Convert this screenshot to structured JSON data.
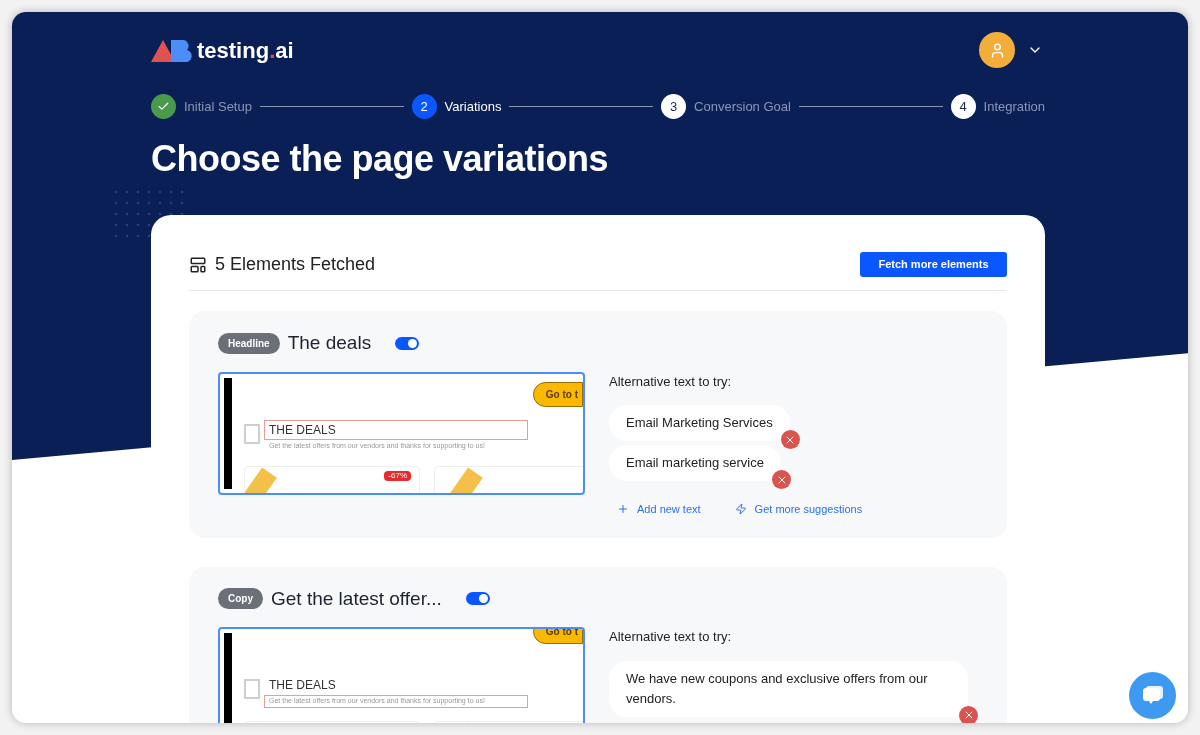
{
  "logo": {
    "name": "testing",
    "dot": ".",
    "suffix": "ai"
  },
  "steps": [
    {
      "label": "Initial Setup",
      "done": true,
      "selected": false
    },
    {
      "number": "2",
      "label": "Variations",
      "done": false,
      "selected": true
    },
    {
      "number": "3",
      "label": "Conversion Goal",
      "done": false,
      "selected": false
    },
    {
      "number": "4",
      "label": "Integration",
      "done": false,
      "selected": false
    }
  ],
  "title": "Choose the page variations",
  "panel": {
    "title": "5 Elements Fetched",
    "fetch_button": "Fetch more elements"
  },
  "elements": [
    {
      "badge": "Headline",
      "name": "The deals",
      "enabled": true,
      "preview": {
        "cta": "Go to t",
        "heading": "THE DEALS",
        "subtext": "Get the latest offers from our vendors and thanks for supporting to us!",
        "discount": "-67%",
        "heading_highlighted": true,
        "subtext_highlighted": false,
        "cta_cut": false
      },
      "alternatives_label": "Alternative text to try:",
      "alternatives": [
        "Email Marketing Services",
        "Email marketing service"
      ],
      "actions": [
        {
          "kind": "add",
          "label": "Add new text"
        },
        {
          "kind": "suggest",
          "label": "Get more suggestions"
        }
      ]
    },
    {
      "badge": "Copy",
      "name": "Get the latest offer...",
      "enabled": true,
      "preview": {
        "cta": "Go to t",
        "heading": "THE DEALS",
        "subtext": "Get the latest offers from our vendors and thanks for supporting to us!",
        "heading_highlighted": false,
        "subtext_highlighted": true,
        "cta_cut": true
      },
      "alternatives_label": "Alternative text to try:",
      "alternatives": [
        "We have new coupons and exclusive offers from our vendors."
      ]
    }
  ]
}
